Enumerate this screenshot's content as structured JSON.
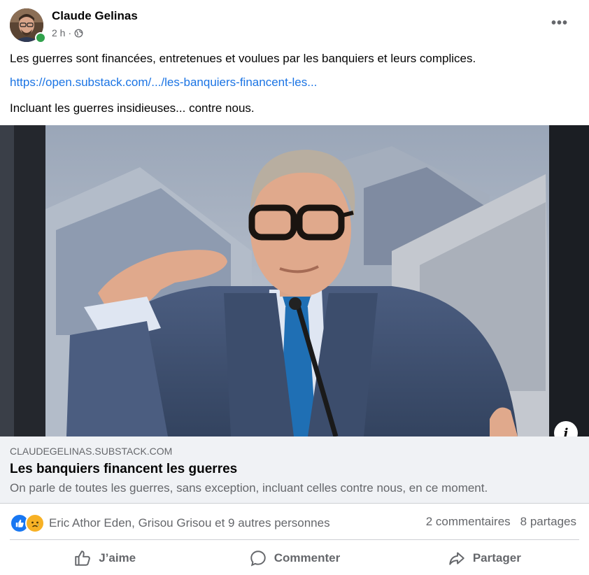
{
  "post": {
    "author": "Claude Gelinas",
    "time": "2 h",
    "separator": "·",
    "privacy_icon": "globe-icon",
    "menu": "•••",
    "text_line1": "Les guerres sont financées, entretenues et voulues par les banquiers et leurs complices.",
    "link_text": "https://open.substack.com/.../les-banquiers-financent-les...",
    "text_line2": "Incluant les guerres insidieuses... contre nous."
  },
  "preview": {
    "domain": "CLAUDEGELINAS.SUBSTACK.COM",
    "title": "Les banquiers financent les guerres",
    "subtitle": "On parle de toutes les guerres, sans exception, incluant celles contre nous, en ce moment.",
    "info_label": "i"
  },
  "engagement": {
    "reaction_icons": [
      "like-reaction-icon",
      "sad-reaction-icon"
    ],
    "reactors": "Eric Athor Eden, Grisou Grisou et 9 autres personnes",
    "comments": "2 commentaires",
    "shares": "8 partages"
  },
  "actions": {
    "like": "J’aime",
    "comment": "Commenter",
    "share": "Partager"
  },
  "colors": {
    "link": "#1b74e4",
    "secondary_text": "#65676b",
    "like_blue": "#1877f2",
    "sad_yellow": "#f7b125",
    "online_green": "#31a24c",
    "preview_bg": "#f0f2f5"
  }
}
